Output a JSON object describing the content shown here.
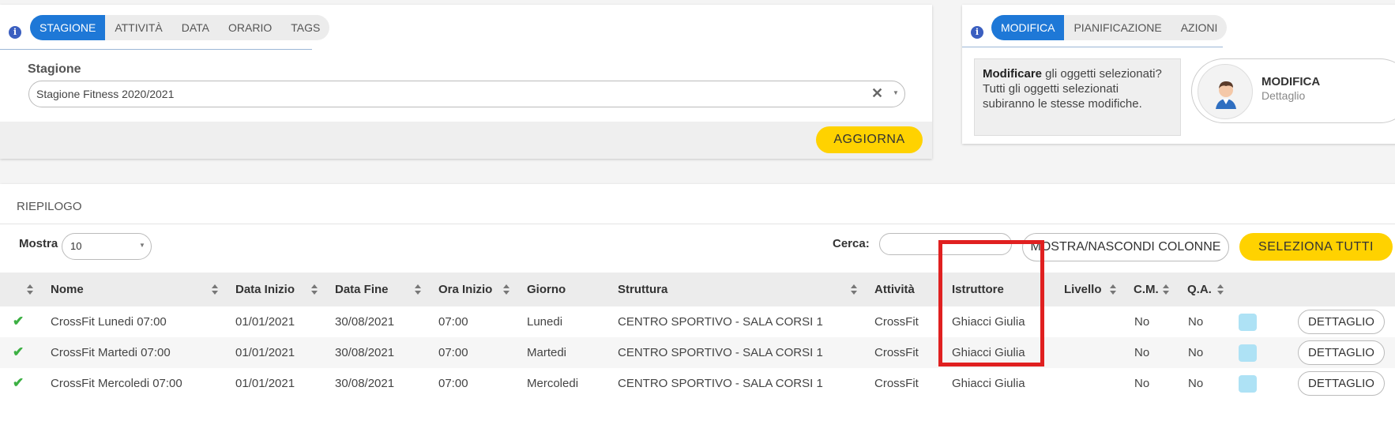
{
  "filter_panel": {
    "tabs": [
      {
        "label": "STAGIONE",
        "active": true
      },
      {
        "label": "ATTIVITÀ",
        "active": false
      },
      {
        "label": "DATA",
        "active": false
      },
      {
        "label": "ORARIO",
        "active": false
      },
      {
        "label": "TAGS",
        "active": false
      }
    ],
    "season_label": "Stagione",
    "season_value": "Stagione Fitness 2020/2021",
    "clear_glyph": "✕",
    "caret_glyph": "▼",
    "update_button": "AGGIORNA"
  },
  "action_panel": {
    "tabs": [
      {
        "label": "MODIFICA",
        "active": true
      },
      {
        "label": "PIANIFICAZIONE",
        "active": false
      },
      {
        "label": "AZIONI",
        "active": false
      }
    ],
    "message_bold": "Modificare",
    "message_rest": " gli oggetti selezionati? Tutti gli oggetti selezionati subiranno le stesse modifiche.",
    "card_title": "MODIFICA",
    "card_subtitle": "Dettaglio"
  },
  "summary": {
    "title": "RIEPILOGO",
    "show_label": "Mostra",
    "page_size": "10",
    "search_label": "Cerca:",
    "search_value": "",
    "toggle_columns_button": "MOSTRA/NASCONDI COLONNE",
    "select_all_button": "SELEZIONA TUTTI",
    "columns": [
      "Nome",
      "Data Inizio",
      "Data Fine",
      "Ora Inizio",
      "Giorno",
      "Struttura",
      "Attività",
      "Istruttore",
      "Livello",
      "C.M.",
      "Q.A."
    ],
    "rows": [
      {
        "nome": "CrossFit Lunedi 07:00",
        "data_inizio": "01/01/2021",
        "data_fine": "30/08/2021",
        "ora_inizio": "07:00",
        "giorno": "Lunedi",
        "struttura": "CENTRO SPORTIVO - SALA CORSI 1",
        "attivita": "CrossFit",
        "istruttore": "Ghiacci Giulia",
        "livello": "",
        "cm": "No",
        "qa": "No",
        "color": "#aee2f5",
        "detail": "DETTAGLIO"
      },
      {
        "nome": "CrossFit Martedi 07:00",
        "data_inizio": "01/01/2021",
        "data_fine": "30/08/2021",
        "ora_inizio": "07:00",
        "giorno": "Martedi",
        "struttura": "CENTRO SPORTIVO - SALA CORSI 1",
        "attivita": "CrossFit",
        "istruttore": "Ghiacci Giulia",
        "livello": "",
        "cm": "No",
        "qa": "No",
        "color": "#aee2f5",
        "detail": "DETTAGLIO"
      },
      {
        "nome": "CrossFit Mercoledi 07:00",
        "data_inizio": "01/01/2021",
        "data_fine": "30/08/2021",
        "ora_inizio": "07:00",
        "giorno": "Mercoledi",
        "struttura": "CENTRO SPORTIVO - SALA CORSI 1",
        "attivita": "CrossFit",
        "istruttore": "Ghiacci Giulia",
        "livello": "",
        "cm": "No",
        "qa": "No",
        "color": "#aee2f5",
        "detail": "DETTAGLIO"
      }
    ]
  },
  "colors": {
    "accent": "#1e78d7",
    "button_yellow": "#ffd200",
    "highlight": "#e02020",
    "check": "#3cb043"
  }
}
